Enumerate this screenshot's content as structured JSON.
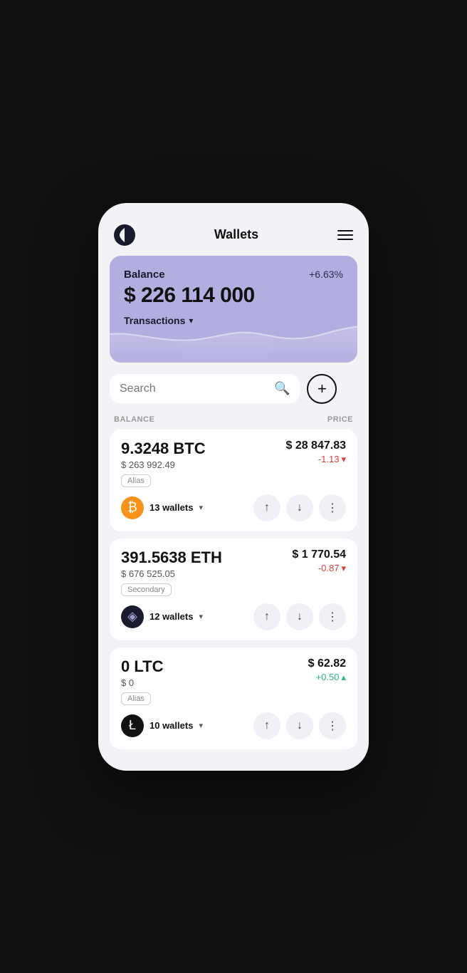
{
  "header": {
    "title": "Wallets",
    "menu_label": "menu"
  },
  "balance_card": {
    "label": "Balance",
    "percentage": "+6.63%",
    "amount": "$ 226 114 000",
    "transactions_label": "Transactions"
  },
  "search": {
    "placeholder": "Search",
    "add_button_label": "+"
  },
  "columns": {
    "balance": "BALANCE",
    "price": "PRICE"
  },
  "assets": [
    {
      "amount": "9.3248 BTC",
      "usd_value": "$ 263 992.49",
      "alias": "Alias",
      "wallet_count": "13 wallets",
      "price": "$ 28 847.83",
      "change": "-1.13",
      "change_type": "negative",
      "crypto": "BTC"
    },
    {
      "amount": "391.5638 ETH",
      "usd_value": "$ 676 525.05",
      "alias": "Secondary",
      "wallet_count": "12 wallets",
      "price": "$ 1 770.54",
      "change": "-0.87",
      "change_type": "negative",
      "crypto": "ETH"
    },
    {
      "amount": "0 LTC",
      "usd_value": "$ 0",
      "alias": "Alias",
      "wallet_count": "10 wallets",
      "price": "$ 62.82",
      "change": "+0.50",
      "change_type": "positive",
      "crypto": "LTC"
    }
  ]
}
